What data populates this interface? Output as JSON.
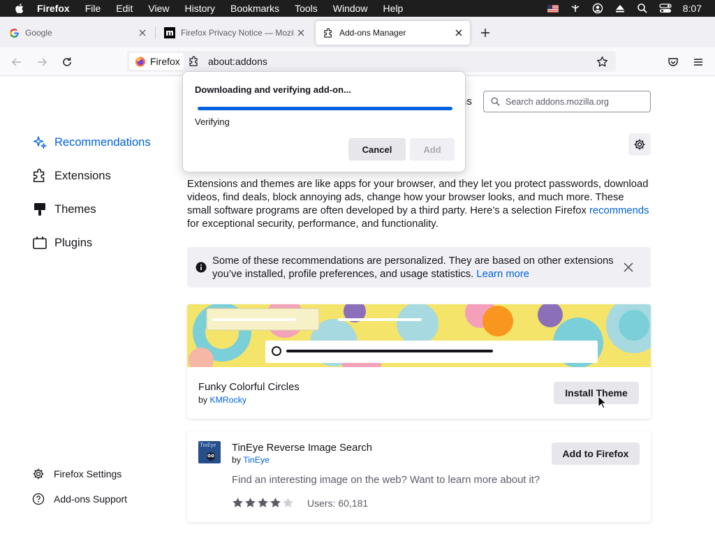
{
  "menubar": {
    "app": "Firefox",
    "items": [
      "File",
      "Edit",
      "View",
      "History",
      "Bookmarks",
      "Tools",
      "Window",
      "Help"
    ],
    "clock": "8:07"
  },
  "tabs": [
    {
      "title": "Google",
      "icon": "google-icon"
    },
    {
      "title": "Firefox Privacy Notice — Mozilla",
      "icon": "mozilla-icon"
    },
    {
      "title": "Add-ons Manager",
      "icon": "addons-icon",
      "active": true
    }
  ],
  "urlbar": {
    "identity_label": "Firefox",
    "url": "about:addons"
  },
  "sidebar": {
    "items": [
      {
        "label": "Recommendations",
        "icon": "sparkle-icon",
        "active": true
      },
      {
        "label": "Extensions",
        "icon": "puzzle-icon"
      },
      {
        "label": "Themes",
        "icon": "brush-icon"
      },
      {
        "label": "Plugins",
        "icon": "plugin-icon"
      }
    ],
    "footer": [
      {
        "label": "Firefox Settings",
        "icon": "gear-icon"
      },
      {
        "label": "Add-ons Support",
        "icon": "help-icon"
      }
    ]
  },
  "main": {
    "heading_fragment": "ns",
    "search_placeholder": "Search addons.mozilla.org",
    "intro_before": "Extensions and themes are like apps for your browser, and they let you protect passwords, download videos, find deals, block annoying ads, change how your browser looks, and much more. These small software programs are often developed by a third party. Here’s a selection Firefox ",
    "intro_link": "recommends",
    "intro_after": " for exceptional security, performance, and functionality.",
    "notice_text": "Some of these recommendations are personalized. They are based on other extensions you’ve installed, profile preferences, and usage statistics. ",
    "notice_link": "Learn more"
  },
  "theme_card": {
    "name": "Funky Colorful Circles",
    "by": "by ",
    "author": "KMRocky",
    "button": "Install Theme"
  },
  "extension_card": {
    "name": "TinEye Reverse Image Search",
    "icon_text": "TinEye",
    "by": "by ",
    "author": "TinEye",
    "button": "Add to Firefox",
    "description": "Find an interesting image on the web? Want to learn more about it?",
    "rating": 4,
    "rating_max": 5,
    "users": "Users: 60,181"
  },
  "popup": {
    "title": "Downloading and verifying add-on...",
    "progress": 1.0,
    "status": "Verifying",
    "cancel": "Cancel",
    "add": "Add"
  },
  "colors": {
    "accent": "#0061e0",
    "menubar_bg": "#1e1e1e",
    "tabstrip_bg": "#f0f0f4"
  }
}
